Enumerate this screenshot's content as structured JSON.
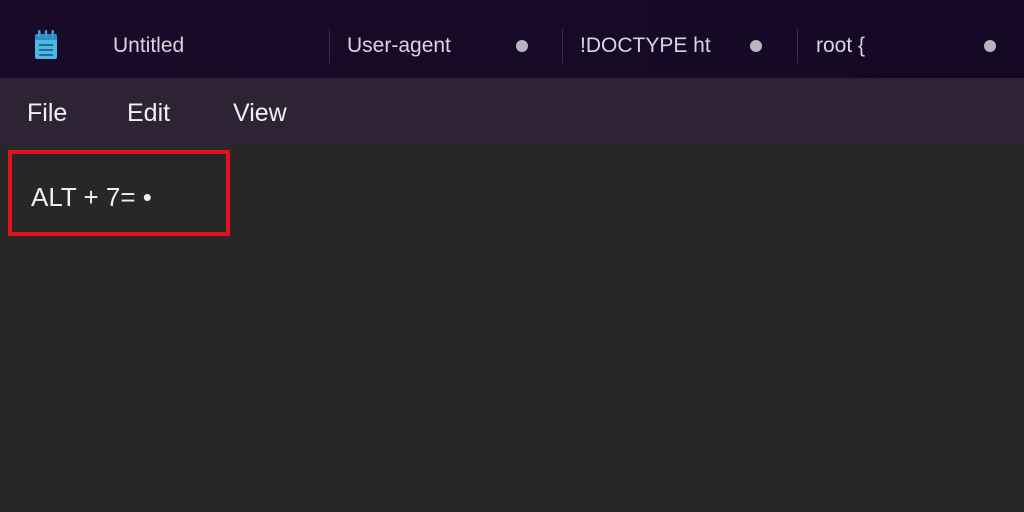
{
  "app": {
    "icon": "notepad-icon"
  },
  "tabs": [
    {
      "title": "Untitled",
      "modified": false
    },
    {
      "title": "User-agent",
      "modified": true
    },
    {
      "title": "!DOCTYPE ht",
      "modified": true
    },
    {
      "title": "root {",
      "modified": true
    }
  ],
  "menu": {
    "file": "File",
    "edit": "Edit",
    "view": "View"
  },
  "editor": {
    "text": "ALT + 7= •"
  },
  "colors": {
    "tab_strip": "#1a0a2a",
    "menu_bar": "#2d2335",
    "editor_bg": "#272727",
    "highlight": "#e0111c"
  }
}
